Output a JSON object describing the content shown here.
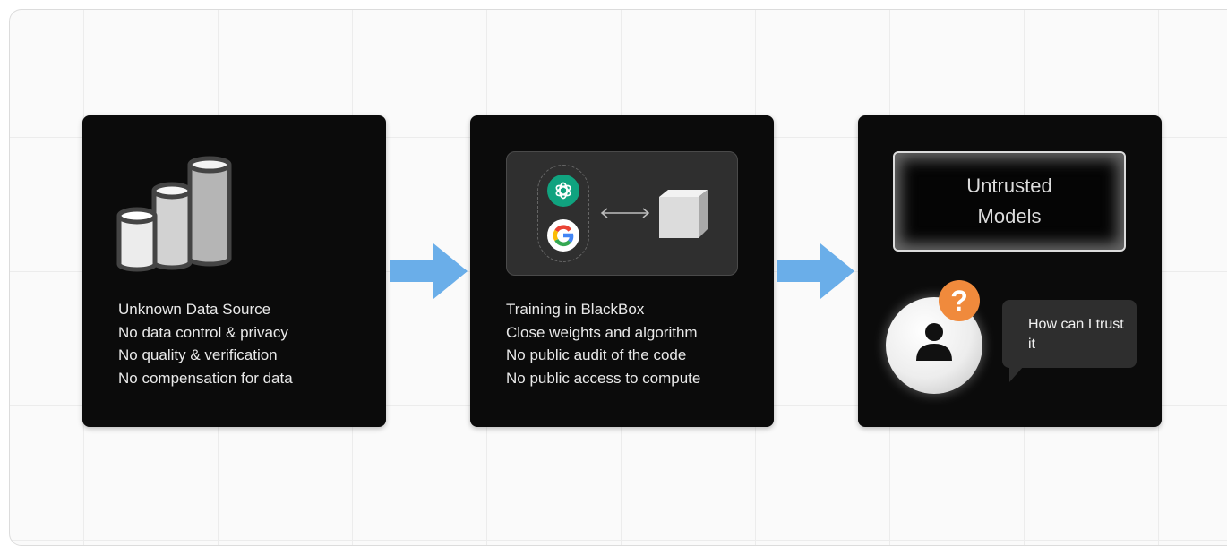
{
  "panels": [
    {
      "name": "data-source",
      "bullets": [
        "Unknown Data Source",
        "No data control & privacy",
        "No quality & verification",
        "No compensation for data"
      ]
    },
    {
      "name": "training",
      "bullets": [
        "Training in BlackBox",
        "Close weights and algorithm",
        "No public audit of the code",
        "No public access to compute"
      ]
    },
    {
      "name": "models",
      "model_box": {
        "line1": "Untrusted",
        "line2": "Models"
      },
      "badge": "?",
      "bubble_text": "How can I trust it"
    }
  ],
  "icons": {
    "panel1": "database-cylinders-icon",
    "panel2": [
      "openai-logo-icon",
      "google-logo-icon",
      "double-arrow-icon",
      "blackbox-cube-icon"
    ],
    "panel3": [
      "person-icon",
      "question-mark-icon",
      "speech-bubble-icon"
    ]
  },
  "colors": {
    "panel_bg": "#0b0b0b",
    "arrow": "#6aaee9",
    "openai_green": "#10a37f",
    "badge_orange": "#f08a3c"
  }
}
